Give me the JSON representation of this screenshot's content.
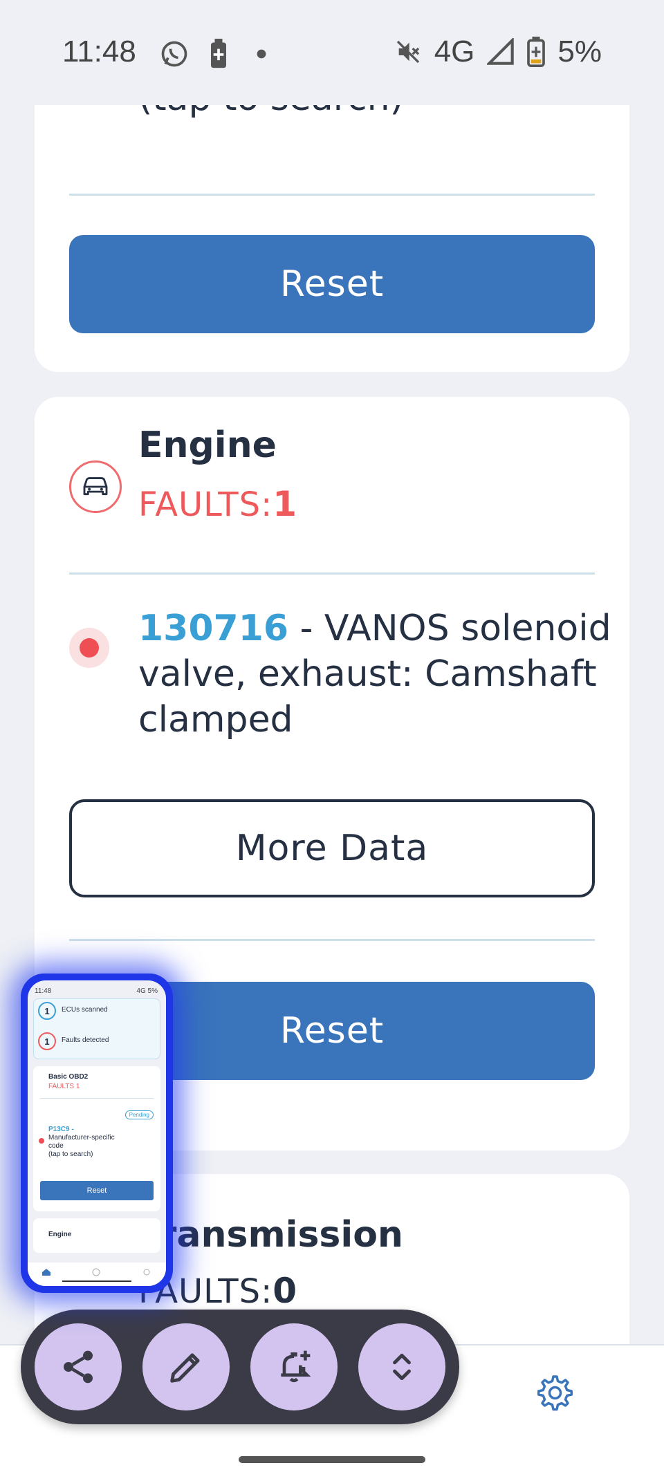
{
  "status_bar": {
    "time": "11:48",
    "network": "4G",
    "battery": "5%"
  },
  "search_card": {
    "search_hint": "(tap to search)",
    "reset_label": "Reset"
  },
  "engine_card": {
    "title": "Engine",
    "faults_label": "FAULTS:",
    "faults_count": "1",
    "fault": {
      "code": "130716",
      "separator": " - ",
      "description": "VANOS solenoid valve, exhaust: Camshaft clamped"
    },
    "more_data_label": "More Data",
    "reset_label": "Reset"
  },
  "transmission_card": {
    "title": "Transmission",
    "faults_label": "FAULTS:",
    "faults_count": "0"
  },
  "thumbnail": {
    "time": "11:48",
    "status_right": "4G 5%",
    "ecus_count": "1",
    "ecus_label": "ECUs scanned",
    "faults_count": "1",
    "faults_label": "Faults detected",
    "system_title": "Basic OBD2",
    "system_faults": "FAULTS 1",
    "pending": "Pending",
    "code": "P13C9",
    "code_sep": " -",
    "desc_line1": "Manufacturer-specific",
    "desc_line2": "code",
    "desc_line3": "(tap to search)",
    "reset_label": "Reset",
    "engine_label": "Engine"
  },
  "colors": {
    "accent_blue": "#3a74bb",
    "code_blue": "#3a9fd4",
    "fault_red": "#ee5a5c",
    "fab_purple": "#d2c4ee",
    "fab_bar": "#3b3b48"
  }
}
